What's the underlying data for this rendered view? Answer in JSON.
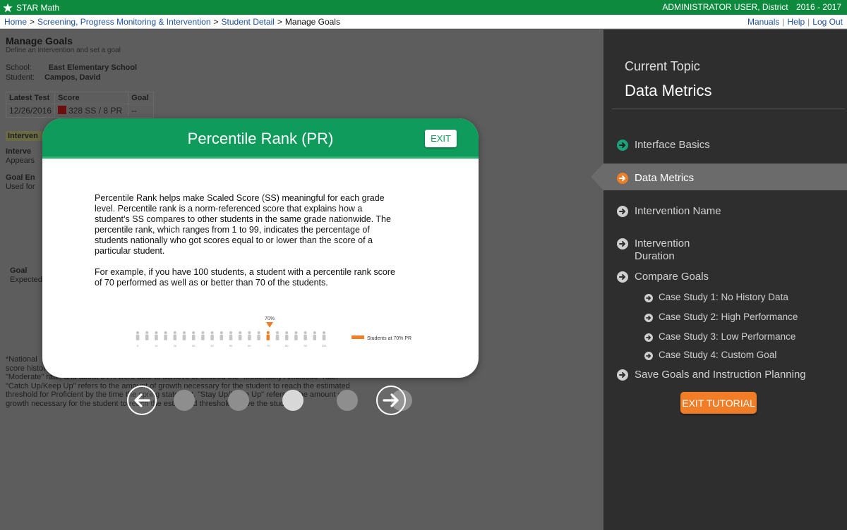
{
  "app": {
    "name": "STAR Math"
  },
  "header": {
    "user": "ADMINISTRATOR USER, District",
    "year": "2016 - 2017"
  },
  "breadcrumb": {
    "items": [
      "Home",
      "Screening, Progress Monitoring & Intervention",
      "Student Detail"
    ],
    "current": "Manage Goals"
  },
  "top_links": [
    "Manuals",
    "Help",
    "Log Out"
  ],
  "background_page": {
    "title": "Manage Goals",
    "subtitle": "Define an intervention and set a goal",
    "school_label": "School:",
    "school": "East Elementary School",
    "student_label": "Student:",
    "student": "Campos, David",
    "table_headers": [
      "Latest Test",
      "Score",
      "Goal"
    ],
    "latest_test": "12/26/2016",
    "score": "328 SS / 8 PR",
    "goal": "--",
    "row_labels": {
      "intervention_header": "Interven",
      "intervention": "Interve",
      "appears": "Appears",
      "goal_end": "Goal En",
      "used_for": "Used for",
      "goal": "Goal",
      "expected": "Expected"
    },
    "notes": {
      "line1": "*National",
      "line2": "score histor",
      "line3": "\"Moderate\" rate, and about 34% were able to achieve or exceed the \"Moderately Ambitious\" rate.",
      "line4": "\"Catch Up/Keep Up\" refers to the amount of growth necessary for the student to reach the estimated",
      "line5": "threshold for Proficient by the time the spring state test. \"Stay Up/Move Up\" refers to the amount of",
      "line6": "growth necessary for the student to reach the estimated threshold above the student."
    }
  },
  "modal": {
    "title": "Percentile Rank  (PR)",
    "exit_label": "EXIT",
    "paragraph1": "Percentile Rank helps make Scaled Score (SS) meaningful for each grade level. Percentile rank is a norm-referenced score that explains how a student’s SS compares to other students in the same grade nationwide. The percentile rank, which ranges from 1 to 99, indicates the percentage of students nationally who got scores equal to or lower than the score of a particular student.",
    "paragraph2": "For example, if you have 100 students, a student with a percentile rank score of 70 performed as well as or better than 70 of the students.",
    "figure": {
      "marker_label": "70%",
      "legend": "Students at 70% PR",
      "tick_labels": [
        "0",
        "10",
        "20",
        "30",
        "40",
        "50",
        "60",
        "70",
        "80",
        "90",
        "100"
      ],
      "highlight_color": "#f27d27"
    }
  },
  "carousel": {
    "slide_count": 5,
    "active_index": 2
  },
  "panel": {
    "current_topic_label": "Current Topic",
    "current_topic": "Data Metrics",
    "items": [
      {
        "label": "Interface Basics",
        "state": "done"
      },
      {
        "label": "Data Metrics",
        "state": "active"
      },
      {
        "label": "Intervention Name",
        "state": "todo"
      },
      {
        "label": "Intervention",
        "label2": "Duration",
        "state": "todo"
      },
      {
        "label": "Compare Goals",
        "state": "todo"
      },
      {
        "label": "Case Study 1: No History Data",
        "state": "todo",
        "sub": true
      },
      {
        "label": "Case Study 2: High Performance",
        "state": "todo",
        "sub": true
      },
      {
        "label": "Case Study 3: Low Performance",
        "state": "todo",
        "sub": true
      },
      {
        "label": "Case Study 4: Custom Goal",
        "state": "todo",
        "sub": true
      },
      {
        "label": "Save Goals and Instruction Planning",
        "state": "todo"
      }
    ],
    "exit_tutorial_label": "EXIT TUTORIAL"
  },
  "colors": {
    "brand_green": "#0e8a3f",
    "modal_green": "#0e9b5b",
    "accent_orange": "#f27d27",
    "done_teal": "#19a27a"
  }
}
